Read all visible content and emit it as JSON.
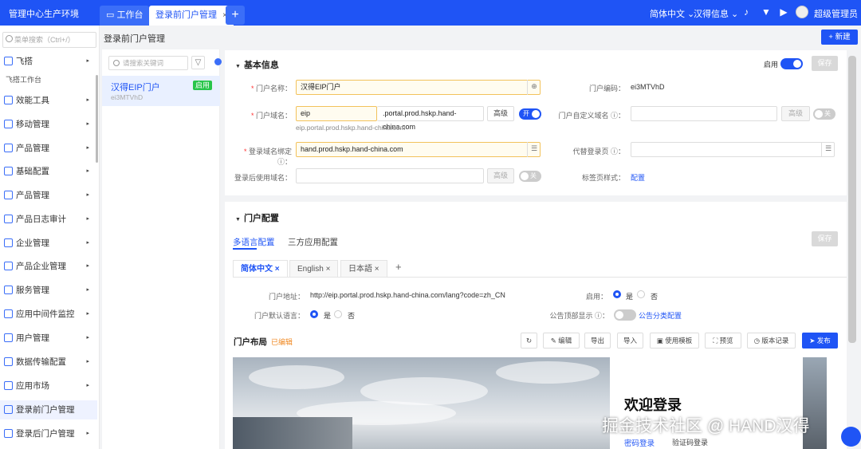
{
  "topbar": {
    "app_title": "管理中心生产环境",
    "tabs": [
      {
        "label": "工作台"
      },
      {
        "label": "登录前门户管理",
        "close": "×"
      }
    ],
    "add": "+",
    "language": "简体中文 ⌄",
    "org": "汉得信息 ⌄",
    "user": "超级管理员 ⌄"
  },
  "sidebar": {
    "search_placeholder": "菜单搜索（Ctrl+/）",
    "sub_label": "飞搭工作台",
    "items": [
      {
        "label": "飞搭",
        "arrow": "▸"
      },
      {
        "label": "效能工具",
        "arrow": "▸"
      },
      {
        "label": "移动管理",
        "arrow": "▸"
      },
      {
        "label": "产品管理",
        "arrow": "▸"
      },
      {
        "label": "基础配置",
        "arrow": "▸"
      },
      {
        "label": "产品管理",
        "arrow": "▸"
      },
      {
        "label": "产品日志审计",
        "arrow": "▸"
      },
      {
        "label": "企业管理",
        "arrow": "▸"
      },
      {
        "label": "产品企业管理",
        "arrow": "▸"
      },
      {
        "label": "服务管理",
        "arrow": "▸"
      },
      {
        "label": "应用中间件监控",
        "arrow": "▸"
      },
      {
        "label": "用户管理",
        "arrow": "▸"
      },
      {
        "label": "数据传输配置",
        "arrow": "▸"
      },
      {
        "label": "应用市场",
        "arrow": "▸"
      },
      {
        "label": "登录前门户管理",
        "arrow": ""
      },
      {
        "label": "登录后门户管理",
        "arrow": "▸"
      }
    ]
  },
  "page": {
    "breadcrumb": "登录前门户管理",
    "new_button": "+ 新建"
  },
  "list": {
    "search_placeholder": "请搜索关键词",
    "filter": "▽",
    "item": {
      "name": "汉得EIP门户",
      "code": "ei3MTVhD",
      "tag": "启用"
    }
  },
  "basic": {
    "title": "基本信息",
    "enable_label": "启用",
    "save": "保存",
    "portal_name_label": "门户名称",
    "portal_name": "汉得EIP门户",
    "portal_code_label": "门户编码",
    "portal_code": "ei3MTVhD",
    "domain_label": "门户域名",
    "domain_prefix": "eip",
    "domain_suffix": ".portal.prod.hskp.hand-china.com",
    "advanced": "高级",
    "toggle_on": "开",
    "domain_hint": "eip.portal.prod.hskp.hand-china.com",
    "custom_domain_label": "门户自定义域名",
    "toggle_off": "关",
    "bind_label": "登录域名绑定",
    "bind_value": "hand.prod.hskp.hand-china.com",
    "proxy_label": "代替登录页",
    "after_login_label": "登录后使用域名",
    "tag_style_label": "标签页样式",
    "tag_style_link": "配置"
  },
  "config": {
    "title": "门户配置",
    "tabs": [
      "多语言配置",
      "三方应用配置"
    ],
    "save": "保存",
    "lang_tabs": [
      {
        "label": "简体中文 ×"
      },
      {
        "label": "English ×"
      },
      {
        "label": "日本語 ×"
      }
    ],
    "lang_add": "+",
    "address_label": "门户地址",
    "address": "http://eip.portal.prod.hskp.hand-china.com/lang?code=zh_CN",
    "enable_label": "启用",
    "yes": "是",
    "no": "否",
    "default_lang_label": "门户默认语言",
    "notice_label": "公告顶部显示",
    "notice_link": "公告分类配置"
  },
  "layout": {
    "title": "门户布局",
    "status": "已编辑",
    "buttons": [
      "编辑",
      "导出",
      "导入",
      "使用模板",
      "预览",
      "版本记录"
    ],
    "publish": "发布"
  },
  "preview": {
    "welcome": "欢迎登录",
    "pwd_login": "密码登录",
    "code_login": "验证码登录"
  },
  "watermark": "掘金技术社区 @ HAND汉得"
}
